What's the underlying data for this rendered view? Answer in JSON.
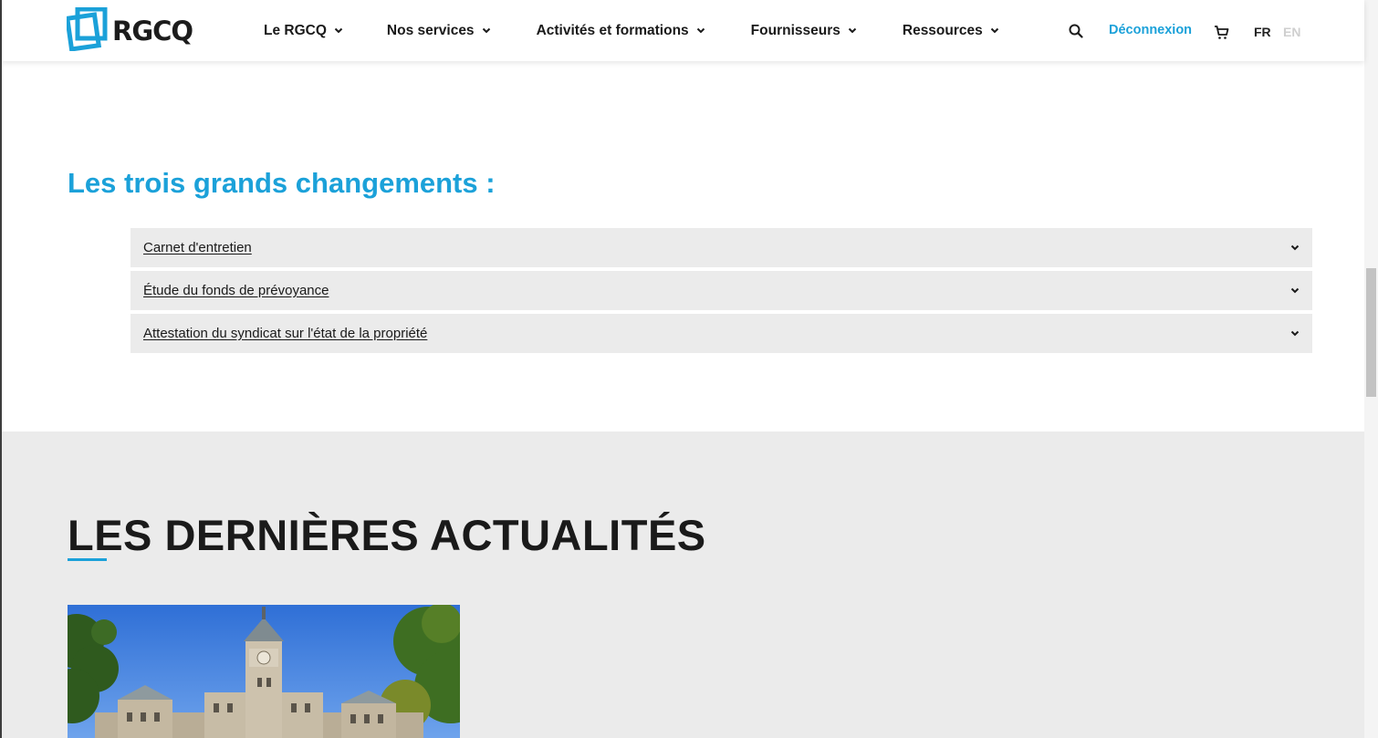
{
  "header": {
    "logo_text": "RGCQ",
    "nav": [
      {
        "label": "Le RGCQ"
      },
      {
        "label": "Nos services"
      },
      {
        "label": "Activités et formations"
      },
      {
        "label": "Fournisseurs"
      },
      {
        "label": "Ressources"
      }
    ],
    "logout_label": "Déconnexion",
    "lang_fr": "FR",
    "lang_en": "EN",
    "icons": {
      "search": "search-icon",
      "cart": "cart-icon",
      "nav_dropdown": "chevron-down-icon"
    }
  },
  "changes": {
    "title": "Les trois grands changements :",
    "items": [
      {
        "label": "Carnet d'entretien"
      },
      {
        "label": "Étude du fonds de prévoyance"
      },
      {
        "label": "Attestation du syndicat sur l'état de la propriété"
      }
    ]
  },
  "news": {
    "title": "LES DERNIÈRES ACTUALITÉS"
  },
  "colors": {
    "accent": "#1ba1d9",
    "text": "#1a1a1a",
    "panel_bg": "#ebebeb",
    "lang_inactive": "#cfcfcf"
  }
}
